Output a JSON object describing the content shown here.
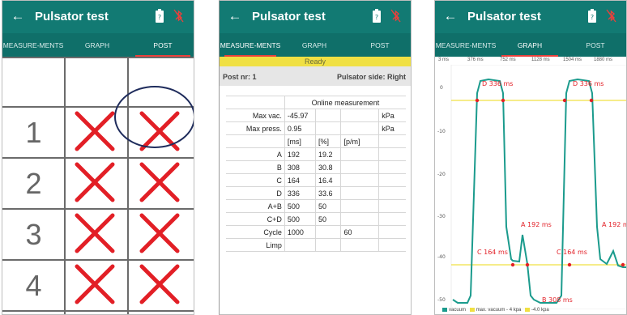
{
  "app": {
    "title": "Pulsator test",
    "back_icon": "back-arrow-icon",
    "battery_icon": "battery-icon",
    "bluetooth_icon": "bluetooth-disabled-icon"
  },
  "tabs": [
    "MEASURE-MENTS",
    "GRAPH",
    "POST"
  ],
  "colors": {
    "appbar": "#127a73",
    "tabbar": "#0f6f69",
    "tab_indicator": "#e8413c",
    "status_ready": "#f0e043",
    "cross": "#e21f26",
    "trace": "#1b9b8d",
    "marker": "#e21f26",
    "max_vacuum_line": "#f0e043",
    "annotation_ellipse": "#1f2c5c"
  },
  "post_grid": {
    "rows": [
      "1",
      "2",
      "3",
      "4"
    ],
    "cross_icon": "x-cross-icon"
  },
  "measurement": {
    "status": "Ready",
    "post_label": "Post nr: 1",
    "side_label": "Pulsator side: Right",
    "section_title": "Online measurement",
    "rows": [
      {
        "label": "Max vac.",
        "c1": "-45.97",
        "c2": "",
        "c3": "",
        "c4": "kPa"
      },
      {
        "label": "Max press.",
        "c1": "0.95",
        "c2": "",
        "c3": "",
        "c4": "kPa"
      },
      {
        "label": "",
        "c1": "[ms]",
        "c2": "[%]",
        "c3": "[p/m]",
        "c4": ""
      },
      {
        "label": "A",
        "c1": "192",
        "c2": "19.2",
        "c3": "",
        "c4": ""
      },
      {
        "label": "B",
        "c1": "308",
        "c2": "30.8",
        "c3": "",
        "c4": ""
      },
      {
        "label": "C",
        "c1": "164",
        "c2": "16.4",
        "c3": "",
        "c4": ""
      },
      {
        "label": "D",
        "c1": "336",
        "c2": "33.6",
        "c3": "",
        "c4": ""
      },
      {
        "label": "A+B",
        "c1": "500",
        "c2": "50",
        "c3": "",
        "c4": ""
      },
      {
        "label": "C+D",
        "c1": "500",
        "c2": "50",
        "c3": "",
        "c4": ""
      },
      {
        "label": "Cycle",
        "c1": "1000",
        "c2": "",
        "c3": "60",
        "c4": ""
      },
      {
        "label": "Limp",
        "c1": "",
        "c2": "",
        "c3": "",
        "c4": ""
      }
    ]
  },
  "graph": {
    "x_ticks": [
      "3 ms",
      "376 ms",
      "752 ms",
      "1128 ms",
      "1504 ms",
      "1880 ms"
    ],
    "y_ticks": [
      "0",
      "-10",
      "-20",
      "-30",
      "-40",
      "-50"
    ],
    "annotations": {
      "d": "D 336 ms",
      "a": "A 192 ms",
      "c": "C 164 ms",
      "b": "B 308 ms"
    },
    "legend": [
      "vacuum",
      "max. vacuum - 4 kpa",
      "-4.0 kpa"
    ],
    "legend_colors": [
      "#1b9b8d",
      "#f0e043",
      "#f0e043"
    ]
  }
}
